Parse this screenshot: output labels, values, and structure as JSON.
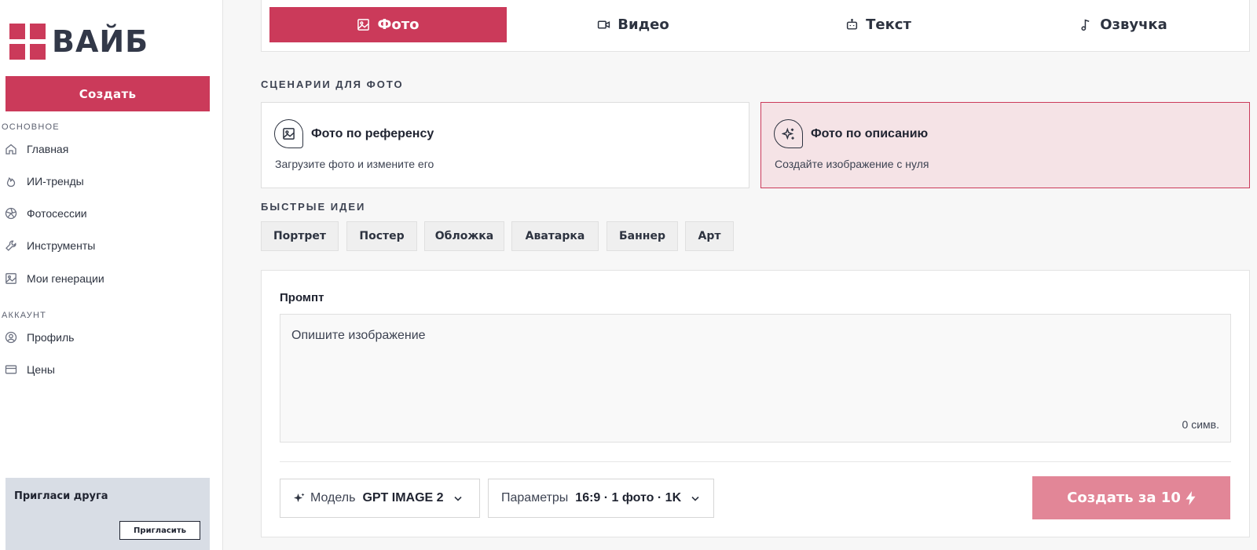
{
  "brand": {
    "name": "ВАЙБ",
    "accent": "#cb3a5a"
  },
  "sidebar": {
    "create_label": "Создать",
    "section_main": "ОСНОВНОЕ",
    "main_items": [
      {
        "label": "Главная",
        "icon": "home-icon"
      },
      {
        "label": "ИИ-тренды",
        "icon": "flame-icon"
      },
      {
        "label": "Фотосессии",
        "icon": "aperture-icon"
      },
      {
        "label": "Инструменты",
        "icon": "wrench-icon"
      },
      {
        "label": "Мои генерации",
        "icon": "image-icon"
      }
    ],
    "section_account": "АККАУНТ",
    "account_items": [
      {
        "label": "Профиль",
        "icon": "user-circle-icon"
      },
      {
        "label": "Цены",
        "icon": "credit-card-icon"
      }
    ],
    "invite": {
      "title": "Пригласи друга",
      "button": "Пригласить"
    }
  },
  "tabs": [
    {
      "label": "Фото",
      "icon": "image-icon",
      "active": true
    },
    {
      "label": "Видео",
      "icon": "video-icon",
      "active": false
    },
    {
      "label": "Текст",
      "icon": "bot-icon",
      "active": false
    },
    {
      "label": "Озвучка",
      "icon": "music-note-icon",
      "active": false
    }
  ],
  "scenarios": {
    "heading": "СЦЕНАРИИ ДЛЯ ФОТО",
    "cards": [
      {
        "title": "Фото по референсу",
        "subtitle": "Загрузите фото и измените его",
        "icon": "image-icon",
        "selected": false
      },
      {
        "title": "Фото по описанию",
        "subtitle": "Создайте изображение с нуля",
        "icon": "sparkles-icon",
        "selected": true
      }
    ]
  },
  "quick_ideas": {
    "heading": "БЫСТРЫЕ ИДЕИ",
    "chips": [
      "Портрет",
      "Постер",
      "Обложка",
      "Аватарка",
      "Баннер",
      "Арт"
    ]
  },
  "prompt": {
    "label": "Промпт",
    "placeholder": "Опишите изображение",
    "value": "",
    "char_count": "0 симв."
  },
  "controls": {
    "model_label": "Модель",
    "model_value": "GPT IMAGE 2",
    "params_label": "Параметры",
    "params_value": "16:9 · 1 фото · 1K",
    "submit_label": "Создать за  10"
  }
}
